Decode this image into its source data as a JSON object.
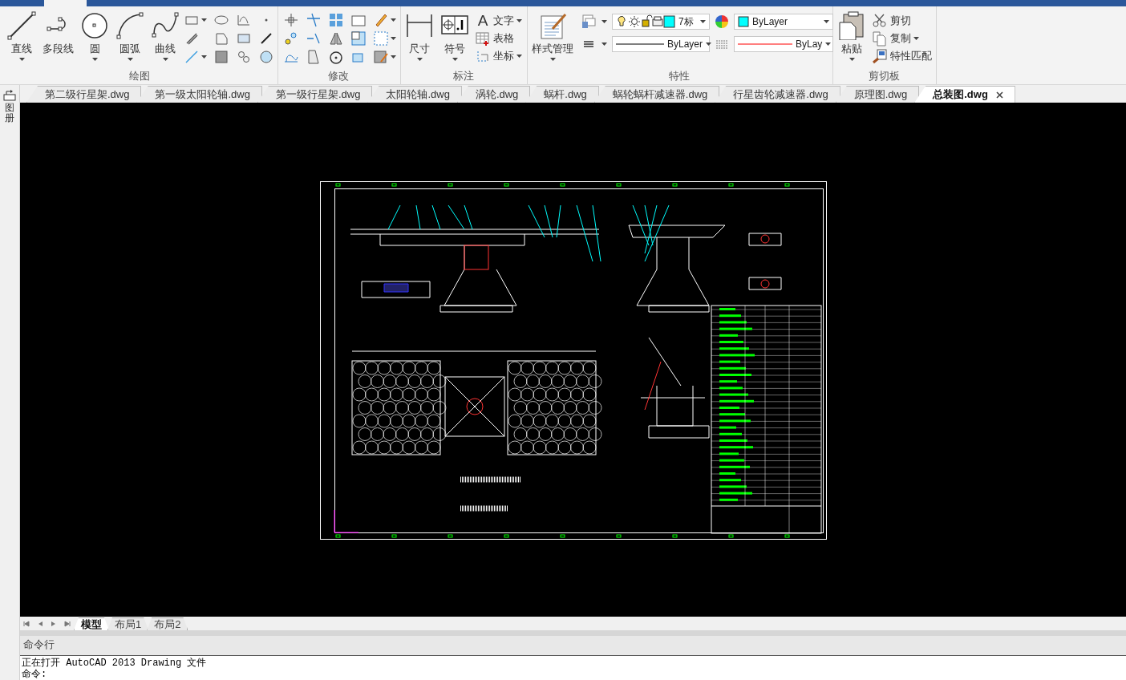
{
  "ribbon": {
    "groups": [
      {
        "kind": "draw",
        "title": "绘图",
        "tools": [
          {
            "label": "直线",
            "dropdown": true
          },
          {
            "label": "多段线",
            "dropdown": false
          },
          {
            "label": "圆",
            "dropdown": true
          },
          {
            "label": "圆弧",
            "dropdown": true
          },
          {
            "label": "曲线",
            "dropdown": true
          }
        ]
      },
      {
        "kind": "modify",
        "title": "修改"
      },
      {
        "kind": "annotate",
        "title": "标注",
        "tools": [
          {
            "label": "尺寸",
            "dropdown": true
          },
          {
            "label": "符号",
            "dropdown": true
          }
        ],
        "small_tools": [
          {
            "label": "文字",
            "dropdown": true,
            "glyph": "A"
          },
          {
            "label": "表格",
            "dropdown": false
          },
          {
            "label": "坐标",
            "dropdown": true
          }
        ]
      },
      {
        "kind": "properties",
        "title": "特性",
        "tools": [
          {
            "label": "样式管理",
            "dropdown": true
          }
        ],
        "layer": "7标",
        "color_setting": "ByLayer",
        "linetype": "ByLayer",
        "lineweight": "ByLay"
      },
      {
        "kind": "clipboard",
        "title": "剪切板",
        "tools": [
          {
            "label": "粘贴",
            "dropdown": true
          }
        ],
        "small_tools": [
          {
            "label": "剪切",
            "dropdown": false
          },
          {
            "label": "复制",
            "dropdown": true
          },
          {
            "label": "特性匹配",
            "dropdown": false
          }
        ]
      }
    ]
  },
  "sidebar": {
    "label": "图册"
  },
  "file_tabs": [
    {
      "label": "第二级行星架.dwg",
      "selected": false
    },
    {
      "label": "第一级太阳轮轴.dwg",
      "selected": false
    },
    {
      "label": "第一级行星架.dwg",
      "selected": false
    },
    {
      "label": "太阳轮轴.dwg",
      "selected": false
    },
    {
      "label": "涡轮.dwg",
      "selected": false
    },
    {
      "label": "蜗杆.dwg",
      "selected": false
    },
    {
      "label": "蜗轮蜗杆减速器.dwg",
      "selected": false
    },
    {
      "label": "行星齿轮减速器.dwg",
      "selected": false
    },
    {
      "label": "原理图.dwg",
      "selected": false
    },
    {
      "label": "总装图.dwg",
      "selected": true
    }
  ],
  "layout_tabs": [
    {
      "label": "模型",
      "selected": true
    },
    {
      "label": "布局1",
      "selected": false
    },
    {
      "label": "布局2",
      "selected": false
    }
  ],
  "command": {
    "title": "命令行",
    "lines": [
      "正在打开 AutoCAD 2013 Drawing 文件",
      "命令:"
    ]
  }
}
